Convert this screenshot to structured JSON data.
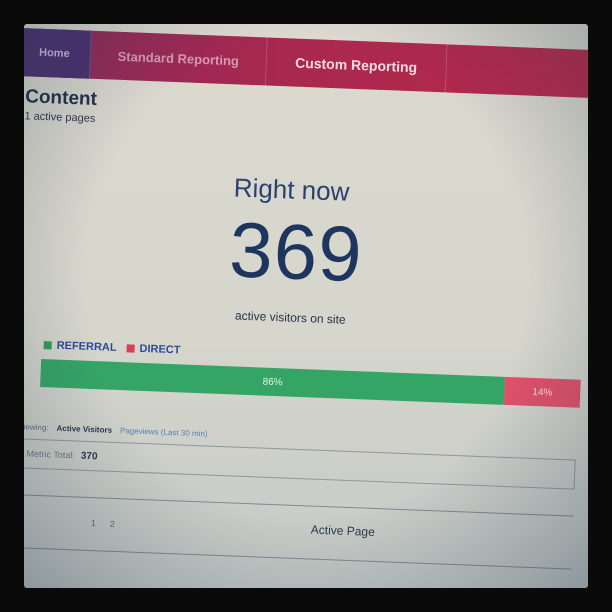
{
  "nav": {
    "items": [
      "Home",
      "Standard Reporting",
      "Custom Reporting"
    ]
  },
  "page": {
    "title": "Content",
    "subtitle": "1 active pages"
  },
  "realtime": {
    "heading": "Right now",
    "count": "369",
    "caption": "active visitors on site"
  },
  "traffic": {
    "legend": [
      {
        "label": "REFERRAL",
        "color": "#2e9a5a"
      },
      {
        "label": "DIRECT",
        "color": "#d6405a"
      }
    ],
    "segments": [
      {
        "name": "referral",
        "label": "86%",
        "share": 0.86,
        "color": "#35a566"
      },
      {
        "name": "direct",
        "label": "14%",
        "share": 0.14,
        "color": "#e0506a"
      }
    ]
  },
  "viewing": {
    "label": "Viewing:",
    "active": "Active Visitors",
    "alternate": "Pageviews (Last 30 min)"
  },
  "metric": {
    "label": "Metric Total:",
    "value": "370"
  },
  "table": {
    "pager": [
      "1",
      "2"
    ],
    "column": "Active Page"
  }
}
